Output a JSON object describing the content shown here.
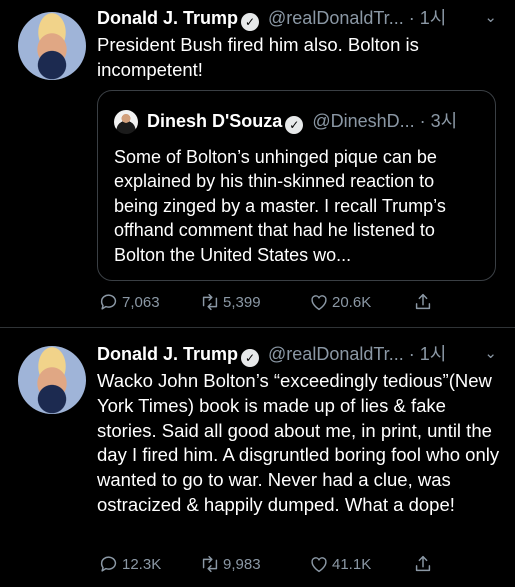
{
  "tweets": [
    {
      "name": "Donald J. Trump",
      "handle": "@realDonaldTr...",
      "time": "· 1시",
      "text": "President Bush fired him also. Bolton is incompetent!",
      "quote": {
        "name": "Dinesh D'Souza",
        "handle": "@DineshD...",
        "time": "· 3시",
        "text": "Some of Bolton’s unhinged pique can be explained by his thin-skinned reaction to being zinged by a master. I recall Trump’s offhand comment that had he listened to Bolton the United States wo..."
      },
      "replies": "7,063",
      "retweets": "5,399",
      "likes": "20.6K"
    },
    {
      "name": "Donald J. Trump",
      "handle": "@realDonaldTr...",
      "time": "· 1시",
      "text": "Wacko John Bolton’s “exceedingly tedious”(New York Times) book is made up of lies & fake stories. Said all good about me, in print, until the day I fired him. A disgruntled boring fool who only wanted to go to war. Never had a clue, was ostracized & happily dumped. What a dope!",
      "replies": "12.3K",
      "retweets": "9,983",
      "likes": "41.1K"
    }
  ],
  "icons": {
    "verified": "verified-badge-icon",
    "more": "chevron-down-icon",
    "reply": "reply-icon",
    "retweet": "retweet-icon",
    "like": "heart-icon",
    "share": "share-icon"
  },
  "colors": {
    "background": "#000000",
    "text": "#ffffff",
    "secondary": "#8b98a5",
    "border": "#3a3f44"
  }
}
